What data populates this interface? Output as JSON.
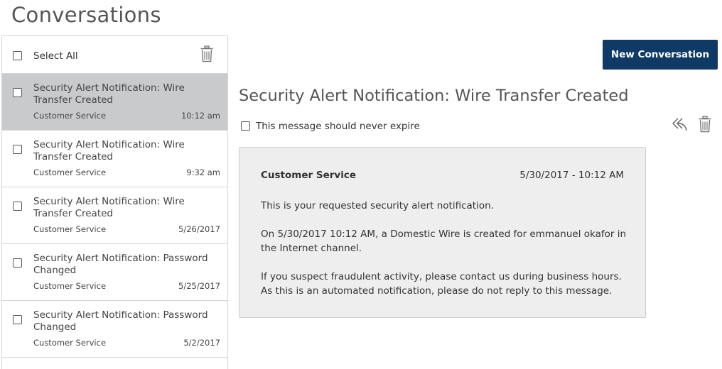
{
  "page_title": "Conversations",
  "sidebar": {
    "select_all_label": "Select All",
    "conversations": [
      {
        "subject": "Security Alert Notification: Wire Transfer Created",
        "sender": "Customer Service",
        "time": "10:12 am",
        "selected": true
      },
      {
        "subject": "Security Alert Notification: Wire Transfer Created",
        "sender": "Customer Service",
        "time": "9:32 am",
        "selected": false
      },
      {
        "subject": "Security Alert Notification: Wire Transfer Created",
        "sender": "Customer Service",
        "time": "5/26/2017",
        "selected": false
      },
      {
        "subject": "Security Alert Notification: Password Changed",
        "sender": "Customer Service",
        "time": "5/25/2017",
        "selected": false
      },
      {
        "subject": "Security Alert Notification: Password Changed",
        "sender": "Customer Service",
        "time": "5/2/2017",
        "selected": false
      }
    ]
  },
  "toolbar": {
    "new_conversation_label": "New Conversation"
  },
  "message": {
    "subject": "Security Alert Notification: Wire Transfer Created",
    "expire_label": "This message should never expire",
    "from": "Customer Service",
    "date": "5/30/2017 - 10:12 AM",
    "paragraphs": [
      "This is your requested security alert notification.",
      "On 5/30/2017 10:12 AM, a Domestic Wire is created for emmanuel okafor in the Internet channel.",
      "If you suspect fraudulent activity, please contact us during business hours. As this is an automated notification, please do not reply to this message."
    ]
  },
  "icons": {
    "select_all_delete": "trash-icon",
    "message_delete": "trash-icon",
    "reply": "reply-icon"
  },
  "colors": {
    "primary_button": "#0f3a66",
    "selected_row": "#c9cacb",
    "message_card": "#eeeeee"
  }
}
